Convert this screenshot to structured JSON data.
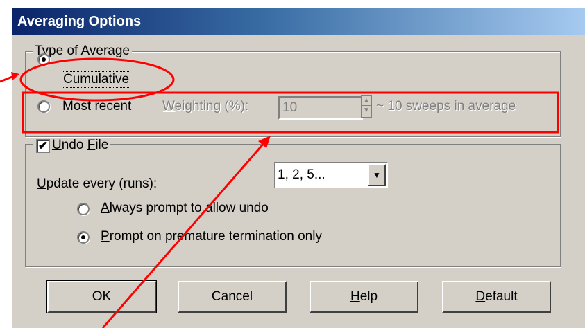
{
  "window": {
    "title": "Averaging Options"
  },
  "type_of_average": {
    "legend": "Type of Average",
    "cumulative": {
      "label": "Cumulative",
      "selected": true
    },
    "most_recent": {
      "label": "Most recent",
      "selected": false
    },
    "weighting": {
      "label": "Weighting (%):",
      "value": "10",
      "suffix": "~ 10 sweeps in average"
    }
  },
  "undo_file": {
    "legend": "Undo File",
    "checked": true,
    "update_label": "Update every (runs):",
    "update_value": "1, 2, 5...",
    "always_prompt": {
      "label": "Always prompt to allow undo",
      "selected": false
    },
    "prompt_premature": {
      "label": "Prompt on premature termination only",
      "selected": true
    }
  },
  "buttons": {
    "ok": "OK",
    "cancel": "Cancel",
    "help": "Help",
    "default": "Default"
  },
  "colors": {
    "annotation": "#ff0000",
    "title_start": "#0a246a",
    "title_end": "#a6caf0",
    "face": "#d4d0c8"
  },
  "icons": {
    "radio": "radio-button",
    "checkbox": "checkmark-icon",
    "dropdown": "chevron-down-icon",
    "spinner": "spinner-arrows-icon"
  }
}
